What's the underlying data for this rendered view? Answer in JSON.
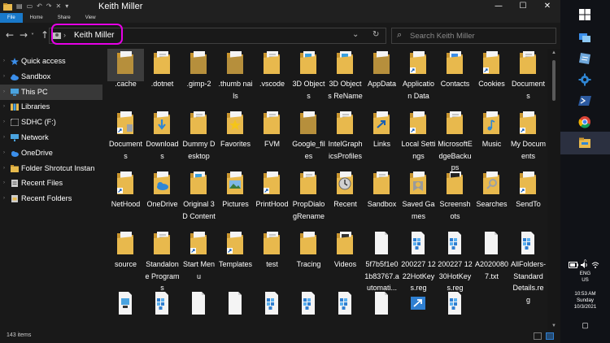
{
  "window": {
    "title": "Keith Miller",
    "minimize_glyph": "—",
    "maximize_glyph": "☐",
    "close_glyph": "✕",
    "undo_glyph": "↶",
    "redo_glyph": "↷",
    "qa_dropdown_glyph": "▾"
  },
  "ribbon": {
    "tabs": [
      "File",
      "Home",
      "Share",
      "View"
    ],
    "active_tab": "File"
  },
  "address": {
    "back_glyph": "←",
    "forward_glyph": "→",
    "recent_glyph": "˅",
    "up_glyph": "↑",
    "crumb_sep": "›",
    "path": "Keith Miller",
    "dropdown_glyph": "⌄",
    "refresh_glyph": "↻",
    "search_placeholder": "Search Keith Miller",
    "search_glyph": "⌕"
  },
  "nav_pane": {
    "expand_glyph": "›",
    "items": [
      {
        "label": "Quick access",
        "icon": "star-icon",
        "color": "#3b8eea"
      },
      {
        "label": "Sandbox",
        "icon": "cloud-icon",
        "color": "#3b8eea"
      },
      {
        "label": "This PC",
        "icon": "computer-icon",
        "color": "#4aa3df",
        "selected": true
      },
      {
        "label": "Libraries",
        "icon": "libraries-icon",
        "color": "#e6b94c"
      },
      {
        "label": "SDHC (F:)",
        "icon": "sd-card-icon",
        "color": "#cccccc"
      },
      {
        "label": "Network",
        "icon": "network-icon",
        "color": "#4aa3df"
      },
      {
        "label": "OneDrive",
        "icon": "onedrive-icon",
        "color": "#3b8eea"
      },
      {
        "label": "Folder Shrotcut Instan",
        "icon": "folder-icon",
        "color": "#e6b94c"
      },
      {
        "label": "Recent Files",
        "icon": "recent-files-icon",
        "color": "#cccccc"
      },
      {
        "label": "Recent Folders",
        "icon": "recent-folders-icon",
        "color": "#cccccc"
      }
    ]
  },
  "content": {
    "items": [
      {
        "label": ".cache",
        "icon": "folder-dim-icon",
        "selected": true
      },
      {
        "label": ".dotnet",
        "icon": "folder-doc-icon"
      },
      {
        "label": ".gimp-2",
        "icon": "folder-dim-icon"
      },
      {
        "label": ".thumb nails",
        "icon": "folder-dim-icon"
      },
      {
        "label": ".vscode",
        "icon": "folder-doc-icon"
      },
      {
        "label": "3D Objects",
        "icon": "folder-3d-icon"
      },
      {
        "label": "3D Objects ReName",
        "icon": "folder-3d-icon"
      },
      {
        "label": "AppData",
        "icon": "folder-dim-icon"
      },
      {
        "label": "Application Data",
        "icon": "folder-shortcut-icon"
      },
      {
        "label": "Contacts",
        "icon": "folder-contacts-icon"
      },
      {
        "label": "Cookies",
        "icon": "folder-shortcut-icon"
      },
      {
        "label": "Documents",
        "icon": "folder-doc-icon"
      },
      {
        "label": "Documents",
        "icon": "folder-shortcut-doc-icon"
      },
      {
        "label": "Downloads",
        "icon": "folder-download-icon"
      },
      {
        "label": "Dummy Desktop",
        "icon": "folder-doc-icon"
      },
      {
        "label": "Favorites",
        "icon": "folder-star-icon"
      },
      {
        "label": "FVM",
        "icon": "folder-doc-icon"
      },
      {
        "label": "Google_files",
        "icon": "folder-dim-icon"
      },
      {
        "label": "IntelGraphicsProfiles",
        "icon": "folder-doc-icon"
      },
      {
        "label": "Links",
        "icon": "folder-links-icon"
      },
      {
        "label": "Local Settings",
        "icon": "folder-shortcut-icon"
      },
      {
        "label": "MicrosoftEdgeBackups",
        "icon": "folder-doc-icon"
      },
      {
        "label": "Music",
        "icon": "folder-music-icon"
      },
      {
        "label": "My Documents",
        "icon": "folder-shortcut-icon"
      },
      {
        "label": "NetHood",
        "icon": "folder-shortcut-icon"
      },
      {
        "label": "OneDrive",
        "icon": "folder-onedrive-icon"
      },
      {
        "label": "Original 3D Content",
        "icon": "folder-3d-icon"
      },
      {
        "label": "Pictures",
        "icon": "folder-pictures-icon"
      },
      {
        "label": "PrintHood",
        "icon": "folder-shortcut-icon"
      },
      {
        "label": "PropDialogRename",
        "icon": "folder-doc-icon"
      },
      {
        "label": "Recent",
        "icon": "folder-recent-icon"
      },
      {
        "label": "Sandbox",
        "icon": "folder-doc-icon"
      },
      {
        "label": "Saved Games",
        "icon": "folder-games-icon"
      },
      {
        "label": "Screenshots",
        "icon": "folder-screens-icon"
      },
      {
        "label": "Searches",
        "icon": "folder-search-icon"
      },
      {
        "label": "SendTo",
        "icon": "folder-shortcut-icon"
      },
      {
        "label": "source",
        "icon": "folder-icon"
      },
      {
        "label": "Standalone Programs",
        "icon": "folder-doc-icon"
      },
      {
        "label": "Start Menu",
        "icon": "folder-shortcut-icon"
      },
      {
        "label": "Templates",
        "icon": "folder-shortcut-icon"
      },
      {
        "label": "test",
        "icon": "folder-doc-icon"
      },
      {
        "label": "Tracing",
        "icon": "folder-icon"
      },
      {
        "label": "Videos",
        "icon": "folder-video-icon"
      },
      {
        "label": "5f7b5f1e01b83767.automati...",
        "icon": "file-blank-icon"
      },
      {
        "label": "200227 1222HotKeys.reg",
        "icon": "reg-file-icon"
      },
      {
        "label": "200227 1230HotKeys.reg",
        "icon": "reg-file-icon"
      },
      {
        "label": "A20200807.txt",
        "icon": "file-blank-icon"
      },
      {
        "label": "AllFolders-StandardDetails.reg",
        "icon": "reg-file-icon"
      },
      {
        "label": "",
        "icon": "file-doc-icon"
      },
      {
        "label": "",
        "icon": "reg-file-icon"
      },
      {
        "label": "",
        "icon": "file-blank-icon"
      },
      {
        "label": "",
        "icon": "file-blank-icon"
      },
      {
        "label": "",
        "icon": "reg-file-icon"
      },
      {
        "label": "",
        "icon": "reg-file-icon"
      },
      {
        "label": "",
        "icon": "reg-file-icon"
      },
      {
        "label": "",
        "icon": "file-blank-icon"
      },
      {
        "label": "",
        "icon": "shortcut-blue-icon"
      },
      {
        "label": "",
        "icon": "reg-file-icon"
      }
    ]
  },
  "status": {
    "item_count": "143 items"
  },
  "scrollbar": {
    "up_glyph": "▲",
    "down_glyph": "▼"
  },
  "taskbar": {
    "apps": [
      {
        "name": "windows-start-icon",
        "active": false
      },
      {
        "name": "task-view-icon",
        "active": false
      },
      {
        "name": "notepad-icon",
        "active": false
      },
      {
        "name": "settings-app-icon",
        "active": false
      },
      {
        "name": "powershell-icon",
        "active": false
      },
      {
        "name": "chrome-icon",
        "active": false
      },
      {
        "name": "file-explorer-icon",
        "active": true
      }
    ],
    "tray": {
      "chevron": "^",
      "language": "ENG",
      "region": "US",
      "time": "10:53 AM",
      "day": "Sunday",
      "date": "10/3/2021",
      "notification_glyph": "▢"
    }
  },
  "colors": {
    "folder": "#e8b94d",
    "folder_dark": "#c9952e",
    "accent": "#1979ca",
    "highlight": "#e600e6"
  }
}
